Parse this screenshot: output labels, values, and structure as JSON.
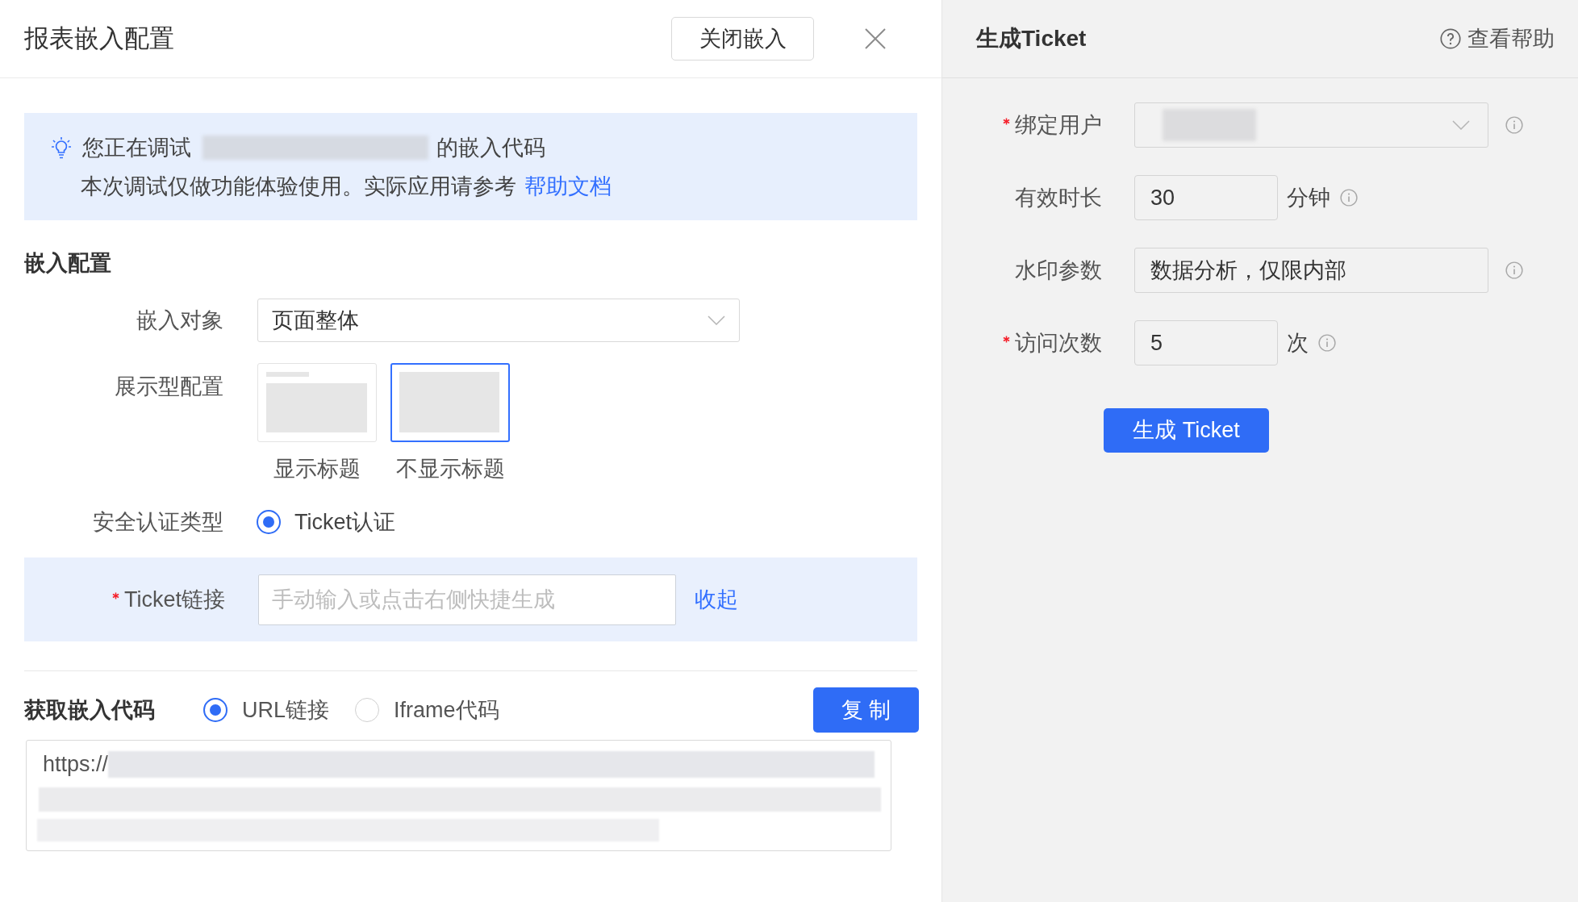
{
  "dialog": {
    "title": "报表嵌入配置",
    "close_embed_button": "关闭嵌入"
  },
  "notice": {
    "line_1_before": "您正在调试",
    "line_1_after": "的嵌入代码",
    "line_2": "本次调试仅做功能体验使用。实际应用请参考",
    "link": "帮助文档"
  },
  "embed_config": {
    "title": "嵌入配置",
    "target": {
      "label": "嵌入对象",
      "value": "页面整体"
    },
    "display": {
      "label": "展示型配置",
      "options": [
        {
          "kind": "with_title",
          "label": "显示标题",
          "selected": false
        },
        {
          "kind": "no_title",
          "label": "不显示标题",
          "selected": true
        }
      ]
    },
    "auth": {
      "label": "安全认证类型",
      "options": [
        {
          "label": "Ticket认证",
          "selected": true
        }
      ]
    },
    "ticket_link": {
      "label": "Ticket链接",
      "required": true,
      "placeholder": "手动输入或点击右侧快捷生成",
      "action": "收起"
    }
  },
  "embed_code": {
    "title": "获取嵌入代码",
    "formats": [
      {
        "label": "URL链接",
        "selected": true
      },
      {
        "label": "Iframe代码",
        "selected": false
      }
    ],
    "copy_button": "复 制",
    "code": "https://"
  },
  "ticket_panel": {
    "title": "生成Ticket",
    "help": "查看帮助",
    "fields": [
      {
        "kind": "select",
        "label": "绑定用户",
        "required": true,
        "info": true
      },
      {
        "kind": "number",
        "label": "有效时长",
        "required": false,
        "value": "30",
        "unit": "分钟",
        "info": true
      },
      {
        "kind": "text",
        "label": "水印参数",
        "required": false,
        "value": "数据分析，仅限内部",
        "info": true
      },
      {
        "kind": "number",
        "label": "访问次数",
        "required": true,
        "value": "5",
        "unit": "次",
        "info": true
      }
    ],
    "generate_button": "生成 Ticket"
  }
}
